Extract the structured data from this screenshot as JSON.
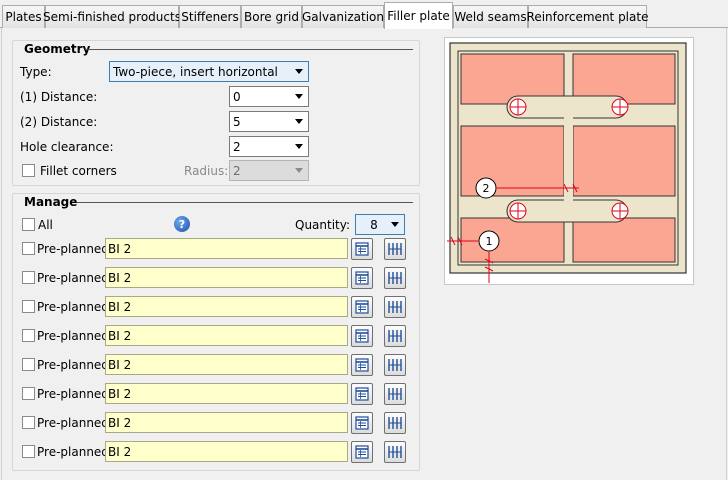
{
  "tabs": [
    {
      "label": "Plates",
      "active": false
    },
    {
      "label": "Semi-finished products",
      "active": false
    },
    {
      "label": "Stiffeners",
      "active": false
    },
    {
      "label": "Bore grid",
      "active": false
    },
    {
      "label": "Galvanization",
      "active": false
    },
    {
      "label": "Filler plate",
      "active": true
    },
    {
      "label": "Weld seams",
      "active": false
    },
    {
      "label": "Reinforcement plate",
      "active": false
    }
  ],
  "geometry": {
    "title": "Geometry",
    "type_label": "Type:",
    "type_value": "Two-piece, insert horizontal",
    "distance1_label": "(1) Distance:",
    "distance1_value": "0",
    "distance2_label": "(2) Distance:",
    "distance2_value": "5",
    "hole_clearance_label": "Hole clearance:",
    "hole_clearance_value": "2",
    "fillet_label": "Fillet corners",
    "radius_label": "Radius:",
    "radius_value": "2"
  },
  "manage": {
    "title": "Manage",
    "all_label": "All",
    "help_glyph": "?",
    "quantity_label": "Quantity:",
    "quantity_value": "8",
    "rows": [
      {
        "label": "Pre-planned",
        "value": "BI 2"
      },
      {
        "label": "Pre-planned",
        "value": "BI 2"
      },
      {
        "label": "Pre-planned",
        "value": "BI 2"
      },
      {
        "label": "Pre-planned",
        "value": "BI 2"
      },
      {
        "label": "Pre-planned",
        "value": "BI 2"
      },
      {
        "label": "Pre-planned",
        "value": "BI 2"
      },
      {
        "label": "Pre-planned",
        "value": "BI 2"
      },
      {
        "label": "Pre-planned",
        "value": "BI 2"
      }
    ]
  },
  "preview": {
    "marker_1": "1",
    "marker_2": "2"
  },
  "icons": {
    "row_button_1": "catalog-table-icon",
    "row_button_2": "dimension-spacing-icon",
    "help": "help-icon"
  },
  "colors": {
    "plate_fill": "#fba593",
    "insert_fill": "#ede4cc",
    "dimension_red": "#e3001b",
    "textbox_bg": "#ffffcc"
  }
}
